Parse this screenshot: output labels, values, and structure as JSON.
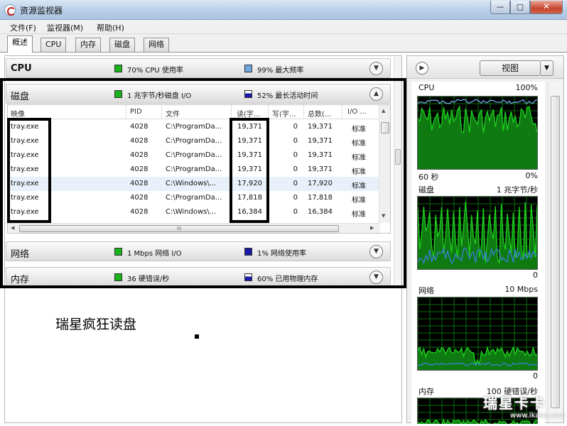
{
  "window": {
    "title": "资源监视器",
    "btn_min": "—",
    "btn_max": "▢",
    "btn_close": "✕"
  },
  "menu": [
    "文件(F)",
    "监视器(M)",
    "帮助(H)"
  ],
  "tabs": [
    "概述",
    "CPU",
    "内存",
    "磁盘",
    "网络"
  ],
  "sections": {
    "cpu": {
      "title": "CPU",
      "ind1_text": "70% CPU 使用率",
      "ind2_text": "99% 最大频率"
    },
    "disk": {
      "title": "磁盘",
      "ind1_text": "1 兆字节/秒磁盘 I/O",
      "ind2_text": "52% 最长活动时间"
    },
    "network": {
      "title": "网络",
      "ind1_text": "1 Mbps 网络 I/O",
      "ind2_text": "1% 网络使用率"
    },
    "memory": {
      "title": "内存",
      "ind1_text": "36 硬错误/秒",
      "ind2_text": "60% 已用物理内存"
    }
  },
  "disk_table": {
    "headers": [
      "映像",
      "PID",
      "文件",
      "读(字...",
      "写(字...",
      "总数(...",
      "I/O ..."
    ],
    "rows": [
      {
        "image": "tray.exe",
        "pid": "4028",
        "file": "C:\\ProgramDa...",
        "read": "19,371",
        "write": "0",
        "total": "19,371",
        "io": "标准"
      },
      {
        "image": "tray.exe",
        "pid": "4028",
        "file": "C:\\ProgramDa...",
        "read": "19,371",
        "write": "0",
        "total": "19,371",
        "io": "标准"
      },
      {
        "image": "tray.exe",
        "pid": "4028",
        "file": "C:\\ProgramDa...",
        "read": "19,371",
        "write": "0",
        "total": "19,371",
        "io": "标准"
      },
      {
        "image": "tray.exe",
        "pid": "4028",
        "file": "C:\\ProgramDa...",
        "read": "19,371",
        "write": "0",
        "total": "19,371",
        "io": "标准"
      },
      {
        "image": "tray.exe",
        "pid": "4028",
        "file": "C:\\Windows\\...",
        "read": "17,920",
        "write": "0",
        "total": "17,920",
        "io": "标准"
      },
      {
        "image": "tray.exe",
        "pid": "4028",
        "file": "C:\\ProgramDa...",
        "read": "17,818",
        "write": "0",
        "total": "17,818",
        "io": "标准"
      },
      {
        "image": "tray.exe",
        "pid": "4028",
        "file": "C:\\Windows\\...",
        "read": "16,384",
        "write": "0",
        "total": "16,384",
        "io": "标准"
      }
    ],
    "hscroll_grip": "III"
  },
  "annotation": "瑞星疯狂读盘",
  "right_pane": {
    "view_button": "视图",
    "graphs": [
      {
        "name": "CPU",
        "max": "100%",
        "time": "60 秒",
        "min": "0%"
      },
      {
        "name": "磁盘",
        "max": "1 兆字节/秒",
        "min": "0"
      },
      {
        "name": "网络",
        "max": "10 Mbps",
        "min": "0"
      },
      {
        "name": "内存",
        "max": "100 硬错误/秒"
      }
    ]
  },
  "watermark": {
    "main": "瑞星卡卡",
    "url": "www.ikaka.com"
  },
  "colors": {
    "graph_green": "#1ed21e",
    "graph_fill": "#0f7a12",
    "graph_blue": "#3a7fd6",
    "grid": "#0a6e0a"
  }
}
